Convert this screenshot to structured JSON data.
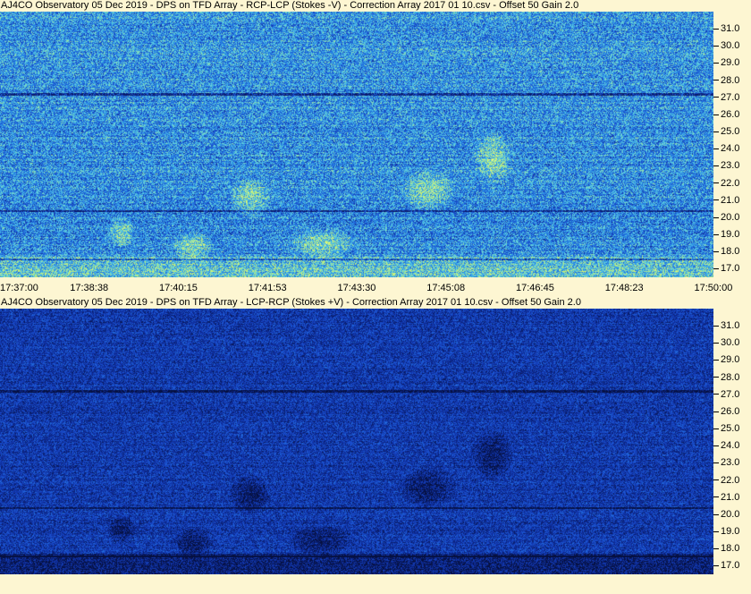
{
  "panels": [
    {
      "title": "AJ4CO Observatory 05 Dec 2019  -  DPS on TFD Array  -  RCP-LCP (Stokes -V)  -  Correction Array 2017 01 10.csv  -  Offset 50  Gain 2.0"
    },
    {
      "title": "AJ4CO Observatory 05 Dec 2019  -  DPS on TFD Array  -  LCP-RCP (Stokes +V)  -  Correction Array 2017 01 10.csv  -  Offset 50  Gain 2.0"
    }
  ],
  "chart_data": [
    {
      "type": "heatmap",
      "title": "AJ4CO Observatory 05 Dec 2019  -  DPS on TFD Array  -  RCP-LCP (Stokes -V)  -  Correction Array 2017 01 10.csv  -  Offset 50  Gain 2.0",
      "x_tick_labels": [
        "17:37:00",
        "17:38:38",
        "17:40:15",
        "17:41:53",
        "17:43:30",
        "17:45:08",
        "17:46:45",
        "17:48:23",
        "17:50:00"
      ],
      "x_range": [
        "17:37:00",
        "17:50:00"
      ],
      "y_tick_labels": [
        "31.0",
        "30.0",
        "29.0",
        "28.0",
        "27.0",
        "26.0",
        "25.0",
        "24.0",
        "23.0",
        "22.0",
        "21.0",
        "20.0",
        "19.0",
        "18.0",
        "17.0"
      ],
      "y_range_mhz": [
        16.5,
        32.0
      ],
      "colormap": [
        "#0a1a6b",
        "#1a4fd0",
        "#2a8ee6",
        "#5fd0e0",
        "#c8f070",
        "#ffff80"
      ],
      "background_color": "#1a4fd0"
    },
    {
      "type": "heatmap",
      "title": "AJ4CO Observatory 05 Dec 2019  -  DPS on TFD Array  -  LCP-RCP (Stokes +V)  -  Correction Array 2017 01 10.csv  -  Offset 50  Gain 2.0",
      "x_range": [
        "17:37:00",
        "17:50:00"
      ],
      "y_tick_labels": [
        "31.0",
        "30.0",
        "29.0",
        "28.0",
        "27.0",
        "26.0",
        "25.0",
        "24.0",
        "23.0",
        "22.0",
        "21.0",
        "20.0",
        "19.0",
        "18.0",
        "17.0"
      ],
      "y_range_mhz": [
        16.5,
        32.0
      ],
      "colormap": [
        "#06103f",
        "#0e2c9a",
        "#1a4fd0",
        "#2a8ee6",
        "#5fd0e0"
      ],
      "background_color": "#163fb8"
    }
  ]
}
